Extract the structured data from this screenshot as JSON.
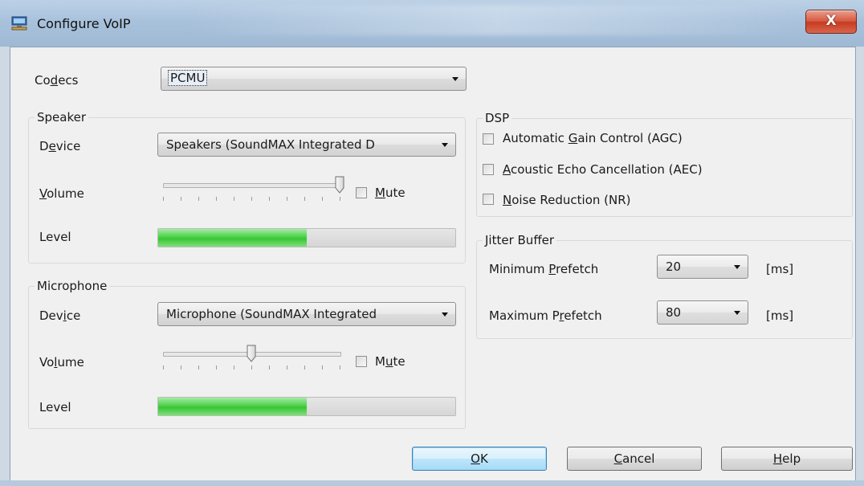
{
  "window": {
    "title": "Configure VoIP",
    "close_glyph": "X"
  },
  "codecs": {
    "label_pre": "Co",
    "label_u": "d",
    "label_post": "ecs",
    "value": "PCMU"
  },
  "speaker": {
    "group_title": "Speaker",
    "device_label_pre": "D",
    "device_label_u": "e",
    "device_label_post": "vice",
    "device_value": "Speakers (SoundMAX Integrated D",
    "volume_label_pre": "",
    "volume_label_u": "V",
    "volume_label_post": "olume",
    "volume_level": 1.0,
    "mute_label_pre": "",
    "mute_label_u": "M",
    "mute_label_post": "ute",
    "mute_checked": false,
    "level_label": "Level",
    "level_fraction": 0.5
  },
  "microphone": {
    "group_title": "Microphone",
    "device_label_pre": "Dev",
    "device_label_u": "i",
    "device_label_post": "ce",
    "device_value": "Microphone (SoundMAX Integrated",
    "volume_label_pre": "Vo",
    "volume_label_u": "l",
    "volume_label_post": "ume",
    "volume_level": 0.5,
    "mute_label_pre": "M",
    "mute_label_u": "u",
    "mute_label_post": "te",
    "mute_checked": false,
    "level_label": "Level",
    "level_fraction": 0.5
  },
  "dsp": {
    "group_title": "DSP",
    "agc": {
      "pre": "Automatic ",
      "u": "G",
      "post": "ain Control (AGC)",
      "checked": false
    },
    "aec": {
      "pre": "",
      "u": "A",
      "post": "coustic Echo Cancellation (AEC)",
      "checked": false
    },
    "nr": {
      "pre": "",
      "u": "N",
      "post": "oise Reduction (NR)",
      "checked": false
    }
  },
  "jitter": {
    "group_title": "Jitter Buffer",
    "min_label_pre": "Minimum ",
    "min_label_u": "P",
    "min_label_post": "refetch",
    "min_value": "20",
    "min_unit": "[ms]",
    "max_label_pre": "Maximum P",
    "max_label_u": "r",
    "max_label_post": "efetch",
    "max_value": "80",
    "max_unit": "[ms]"
  },
  "buttons": {
    "ok_u": "O",
    "ok_post": "K",
    "cancel_u": "C",
    "cancel_post": "ancel",
    "help_u": "H",
    "help_post": "elp"
  }
}
